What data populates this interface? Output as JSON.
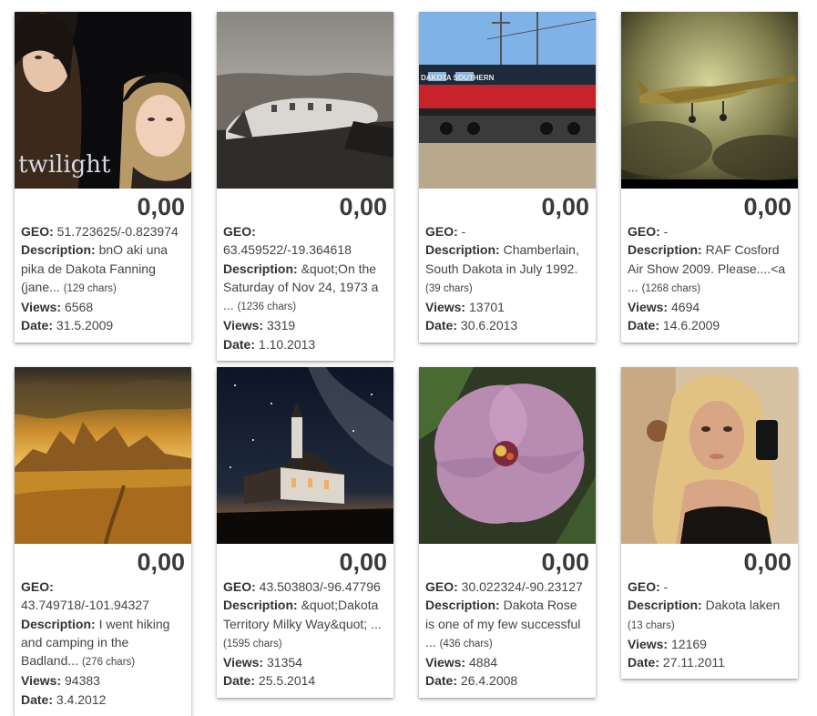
{
  "labels": {
    "geo": "GEO:",
    "description": "Description:",
    "views": "Views:",
    "date": "Date:"
  },
  "cards": [
    {
      "score": "0,00",
      "geo": "51.723625/-0.823974",
      "description": "bnO aki una pika de Dakota Fanning (jane...",
      "chars": "(129 chars)",
      "views": "6568",
      "date": "31.5.2009",
      "image_text": "twilight"
    },
    {
      "score": "0,00",
      "geo": "63.459522/-19.364618",
      "description": "&quot;On the Saturday of Nov 24, 1973 a ...",
      "chars": "(1236 chars)",
      "views": "3319",
      "date": "1.10.2013"
    },
    {
      "score": "0,00",
      "geo": "-",
      "description": "Chamberlain, South Dakota in July 1992.",
      "chars": "(39 chars)",
      "views": "13701",
      "date": "30.6.2013",
      "image_text": "DAKOTA SOUTHERN"
    },
    {
      "score": "0,00",
      "geo": "-",
      "description": "RAF Cosford Air Show 2009. Please....<a ...",
      "chars": "(1268 chars)",
      "views": "4694",
      "date": "14.6.2009"
    },
    {
      "score": "0,00",
      "geo": "43.749718/-101.94327",
      "description": "I went hiking and camping in the Badland...",
      "chars": "(276 chars)",
      "views": "94383",
      "date": "3.4.2012"
    },
    {
      "score": "0,00",
      "geo": "43.503803/-96.47796",
      "description": "&quot;Dakota Territory Milky Way&quot; ...",
      "chars": "(1595 chars)",
      "views": "31354",
      "date": "25.5.2014"
    },
    {
      "score": "0,00",
      "geo": "30.022324/-90.23127",
      "description": "Dakota Rose is one of my few successful ...",
      "chars": "(436 chars)",
      "views": "4884",
      "date": "26.4.2008"
    },
    {
      "score": "0,00",
      "geo": "-",
      "description": "Dakota laken",
      "chars": "(13 chars)",
      "views": "12169",
      "date": "27.11.2011"
    }
  ]
}
